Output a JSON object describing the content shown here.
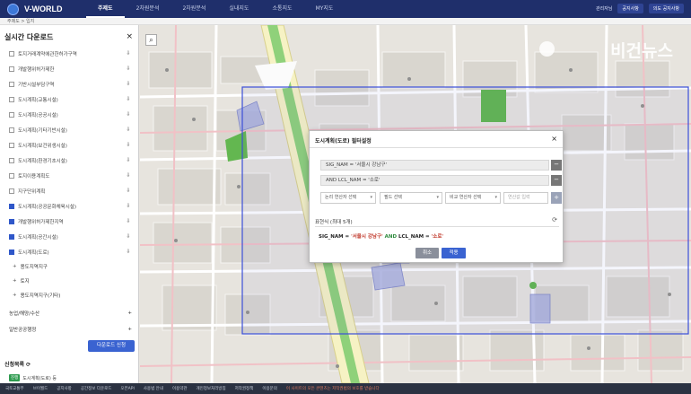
{
  "app": {
    "logo": "V-WORLD"
  },
  "nav": [
    {
      "label": "주제도",
      "active": true
    },
    {
      "label": "2차원분석",
      "active": false
    },
    {
      "label": "2차원분석",
      "active": false
    },
    {
      "label": "실내지도",
      "active": false
    },
    {
      "label": "소통지도",
      "active": false
    },
    {
      "label": "MY지도",
      "active": false
    }
  ],
  "top_right": {
    "link": "관리자님",
    "button1": "공지사항",
    "button2": "의도 공지사항"
  },
  "subbar": "주제도 > 입지",
  "panel": {
    "title": "실시간 다운로드",
    "close": "×",
    "layers": [
      {
        "label": "토지거래계약에관한허가구역",
        "checked": false
      },
      {
        "label": "개발행위허가제한",
        "checked": false
      },
      {
        "label": "기반시설부담구역",
        "checked": false
      },
      {
        "label": "도시계획(교통시설)",
        "checked": false
      },
      {
        "label": "도시계획(공공시설)",
        "checked": false
      },
      {
        "label": "도시계획(기타기반시설)",
        "checked": false
      },
      {
        "label": "도시계획(보건위생시설)",
        "checked": false
      },
      {
        "label": "도시계획(환경기초시설)",
        "checked": false
      },
      {
        "label": "토지이용계획도",
        "checked": false
      },
      {
        "label": "지구단위계획",
        "checked": false
      },
      {
        "label": "도시계획(공공문화체육시설)",
        "checked": true
      },
      {
        "label": "개발행위허가제한지역",
        "checked": true
      },
      {
        "label": "도시계획(공간시설)",
        "checked": true
      },
      {
        "label": "도시계획(도로)",
        "checked": true
      }
    ],
    "groups": [
      {
        "label": "용도지역지구"
      },
      {
        "label": "토지"
      },
      {
        "label": "용도지역지구(기타)"
      }
    ],
    "sections": [
      {
        "label": "농업/해양/수산",
        "icon": "+"
      },
      {
        "label": "일반공공행정",
        "icon": "+"
      }
    ],
    "download_button": "다운로드 신청",
    "request_title": "신청목록",
    "request_badge": "진행",
    "request_item": "도시계획(도로) 등"
  },
  "map": {
    "search_icon": "search-icon",
    "watermark": "비건뉴스"
  },
  "dialog": {
    "title": "도시계획(도로) 필터설정",
    "close": "×",
    "conditions": [
      {
        "text": "SIG_NAM = '서울시 강남구'"
      },
      {
        "text": "AND LCL_NAM = '소로'"
      }
    ],
    "selects": {
      "logic": "논리 연산자 선택",
      "field": "필드 선택",
      "compare": "비교 연산자 선택",
      "value_placeholder": "연산값 입력"
    },
    "expression_label": "표현식 (최대 5개)",
    "expression": {
      "field1": "SIG_NAM",
      "eq1": " = ",
      "value1": "'서울시 강남구'",
      "and": " AND ",
      "field2": "LCL_NAM",
      "eq2": " = ",
      "value2": "'소로'"
    },
    "cancel": "취소",
    "apply": "적용"
  },
  "footer": {
    "items": [
      "국토교통부",
      "브이월드",
      "공지사항",
      "공간정보 다운로드",
      "오픈API",
      "사용법 안내",
      "이용약관",
      "개인정보처리방침",
      "저작권정책",
      "이용문의"
    ],
    "warning": "이 사이트의 모든 콘텐츠는 저작권법의 보호를 받습니다"
  },
  "colors": {
    "nav_bg": "#1f2f6b",
    "accent": "#3a63d1",
    "selection": "#3b4fd8"
  }
}
